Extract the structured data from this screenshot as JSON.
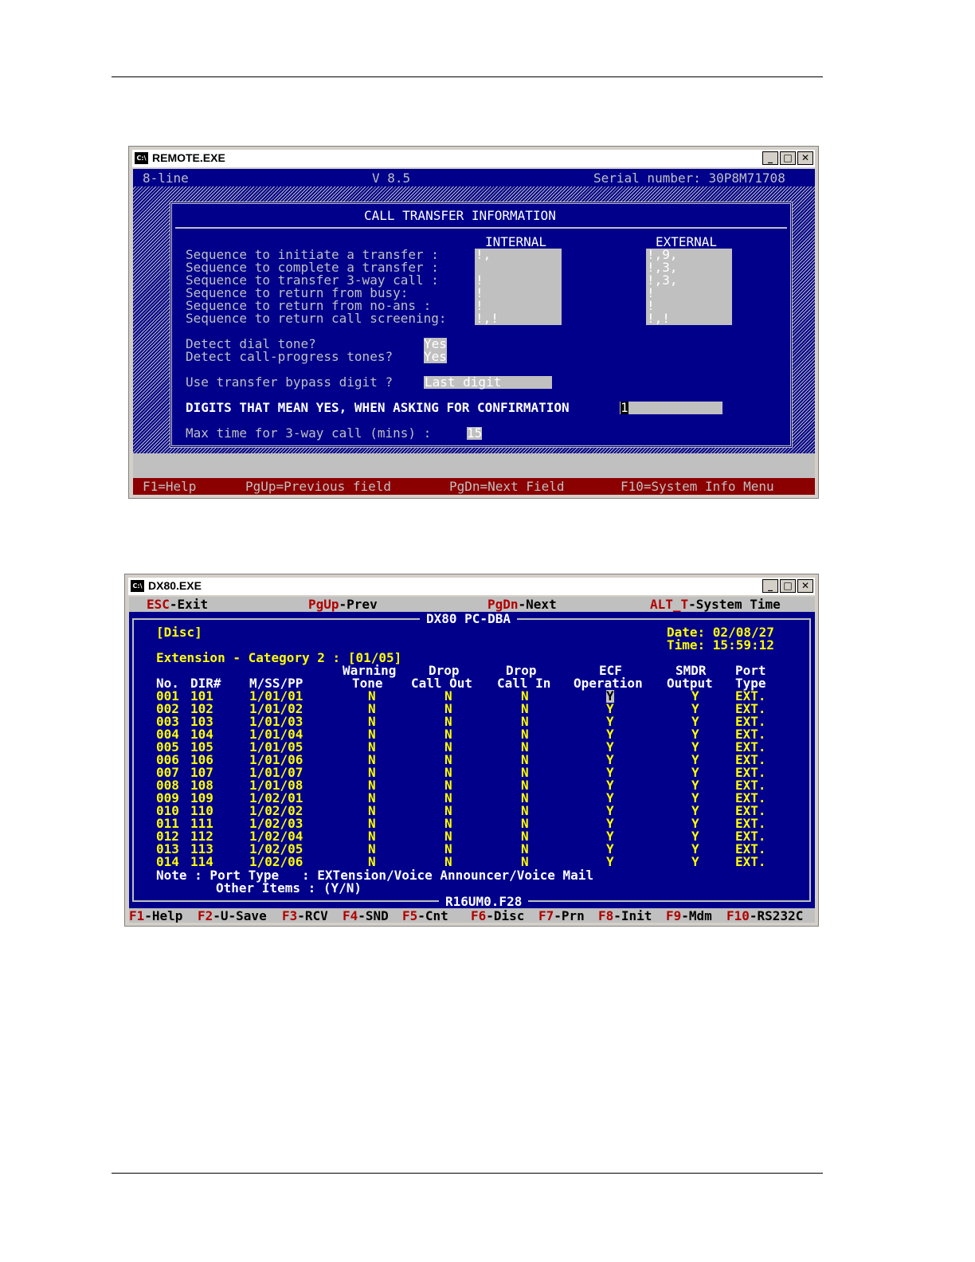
{
  "remote": {
    "title": "REMOTE.EXE",
    "header_left": "8-line",
    "version": "V 8.5",
    "serial": "Serial number: 30P8M71708",
    "panel_title": "CALL TRANSFER INFORMATION",
    "col_internal": "INTERNAL",
    "col_external": "EXTERNAL",
    "sequences": [
      {
        "label": "Sequence to initiate a transfer :",
        "internal": "!,",
        "external": "!,9,"
      },
      {
        "label": "Sequence to complete a transfer :",
        "internal": "",
        "external": "!,3,"
      },
      {
        "label": "Sequence to transfer 3-way call :",
        "internal": "!",
        "external": "!,3,"
      },
      {
        "label": "Sequence to return from busy:",
        "internal": "!",
        "external": "!"
      },
      {
        "label": "Sequence to return from no-ans :",
        "internal": "!",
        "external": "!"
      },
      {
        "label": "Sequence to return call screening:",
        "internal": "!,!",
        "external": "!,!"
      }
    ],
    "detect_dial_label": "Detect dial tone?",
    "detect_dial_value": "Yes",
    "detect_progress_label": "Detect call-progress tones?",
    "detect_progress_value": "Yes",
    "bypass_label": "Use transfer bypass digit ?",
    "bypass_value": "Last digit",
    "digits_label": "DIGITS THAT MEAN YES, WHEN ASKING FOR CONFIRMATION",
    "digits_value": "1",
    "maxtime_label": "Max time for 3-way call (mins) :",
    "maxtime_value": "15",
    "fkeys": [
      "F1=Help",
      "PgUp=Previous field",
      "PgDn=Next Field",
      "F10=System Info Menu"
    ]
  },
  "dx80": {
    "title": "DX80.EXE",
    "top_keys": [
      {
        "key": "ESC",
        "text": "-Exit"
      },
      {
        "key": "PgUp",
        "text": "-Prev"
      },
      {
        "key": "PgDn",
        "text": "-Next"
      },
      {
        "key": "ALT_T",
        "text": "-System Time"
      }
    ],
    "app_title": "DX80 PC-DBA",
    "mode": "[Disc]",
    "date": "Date: 02/08/27",
    "time": "Time: 15:59:12",
    "category": "Extension - Category 2 : [01/05]",
    "headers": {
      "no": "No.",
      "dir": "DIR#",
      "mss": "M/SS/PP",
      "warn1": "Warning",
      "warn2": "Tone",
      "dco1": "Drop",
      "dco2": "Call Out",
      "dci1": "Drop",
      "dci2": "Call In",
      "ecf1": "ECF",
      "ecf2": "Operation",
      "smdr1": "SMDR",
      "smdr2": "Output",
      "port1": "Port",
      "port2": "Type"
    },
    "rows": [
      {
        "no": "001",
        "dir": "101",
        "mss": "1/01/01",
        "warn": "N",
        "dco": "N",
        "dci": "N",
        "ecf": "Y",
        "smdr": "Y",
        "port": "EXT."
      },
      {
        "no": "002",
        "dir": "102",
        "mss": "1/01/02",
        "warn": "N",
        "dco": "N",
        "dci": "N",
        "ecf": "Y",
        "smdr": "Y",
        "port": "EXT."
      },
      {
        "no": "003",
        "dir": "103",
        "mss": "1/01/03",
        "warn": "N",
        "dco": "N",
        "dci": "N",
        "ecf": "Y",
        "smdr": "Y",
        "port": "EXT."
      },
      {
        "no": "004",
        "dir": "104",
        "mss": "1/01/04",
        "warn": "N",
        "dco": "N",
        "dci": "N",
        "ecf": "Y",
        "smdr": "Y",
        "port": "EXT."
      },
      {
        "no": "005",
        "dir": "105",
        "mss": "1/01/05",
        "warn": "N",
        "dco": "N",
        "dci": "N",
        "ecf": "Y",
        "smdr": "Y",
        "port": "EXT."
      },
      {
        "no": "006",
        "dir": "106",
        "mss": "1/01/06",
        "warn": "N",
        "dco": "N",
        "dci": "N",
        "ecf": "Y",
        "smdr": "Y",
        "port": "EXT."
      },
      {
        "no": "007",
        "dir": "107",
        "mss": "1/01/07",
        "warn": "N",
        "dco": "N",
        "dci": "N",
        "ecf": "Y",
        "smdr": "Y",
        "port": "EXT."
      },
      {
        "no": "008",
        "dir": "108",
        "mss": "1/01/08",
        "warn": "N",
        "dco": "N",
        "dci": "N",
        "ecf": "Y",
        "smdr": "Y",
        "port": "EXT."
      },
      {
        "no": "009",
        "dir": "109",
        "mss": "1/02/01",
        "warn": "N",
        "dco": "N",
        "dci": "N",
        "ecf": "Y",
        "smdr": "Y",
        "port": "EXT."
      },
      {
        "no": "010",
        "dir": "110",
        "mss": "1/02/02",
        "warn": "N",
        "dco": "N",
        "dci": "N",
        "ecf": "Y",
        "smdr": "Y",
        "port": "EXT."
      },
      {
        "no": "011",
        "dir": "111",
        "mss": "1/02/03",
        "warn": "N",
        "dco": "N",
        "dci": "N",
        "ecf": "Y",
        "smdr": "Y",
        "port": "EXT."
      },
      {
        "no": "012",
        "dir": "112",
        "mss": "1/02/04",
        "warn": "N",
        "dco": "N",
        "dci": "N",
        "ecf": "Y",
        "smdr": "Y",
        "port": "EXT."
      },
      {
        "no": "013",
        "dir": "113",
        "mss": "1/02/05",
        "warn": "N",
        "dco": "N",
        "dci": "N",
        "ecf": "Y",
        "smdr": "Y",
        "port": "EXT."
      },
      {
        "no": "014",
        "dir": "114",
        "mss": "1/02/06",
        "warn": "N",
        "dco": "N",
        "dci": "N",
        "ecf": "Y",
        "smdr": "Y",
        "port": "EXT."
      }
    ],
    "note_line1": "Note : Port Type   : EXTension/Voice Announcer/Voice Mail",
    "note_line2": "Other Items : (Y/N)",
    "file": "R16UM0.F28",
    "fkeys": [
      {
        "key": "F1",
        "text": "-Help"
      },
      {
        "key": "F2",
        "text": "-U-Save"
      },
      {
        "key": "F3",
        "text": "-RCV"
      },
      {
        "key": "F4",
        "text": "-SND"
      },
      {
        "key": "F5",
        "text": "-Cnt"
      },
      {
        "key": "F6",
        "text": "-Disc"
      },
      {
        "key": "F7",
        "text": "-Prn"
      },
      {
        "key": "F8",
        "text": "-Init"
      },
      {
        "key": "F9",
        "text": "-Mdm"
      },
      {
        "key": "F10",
        "text": "-RS232C"
      }
    ]
  }
}
